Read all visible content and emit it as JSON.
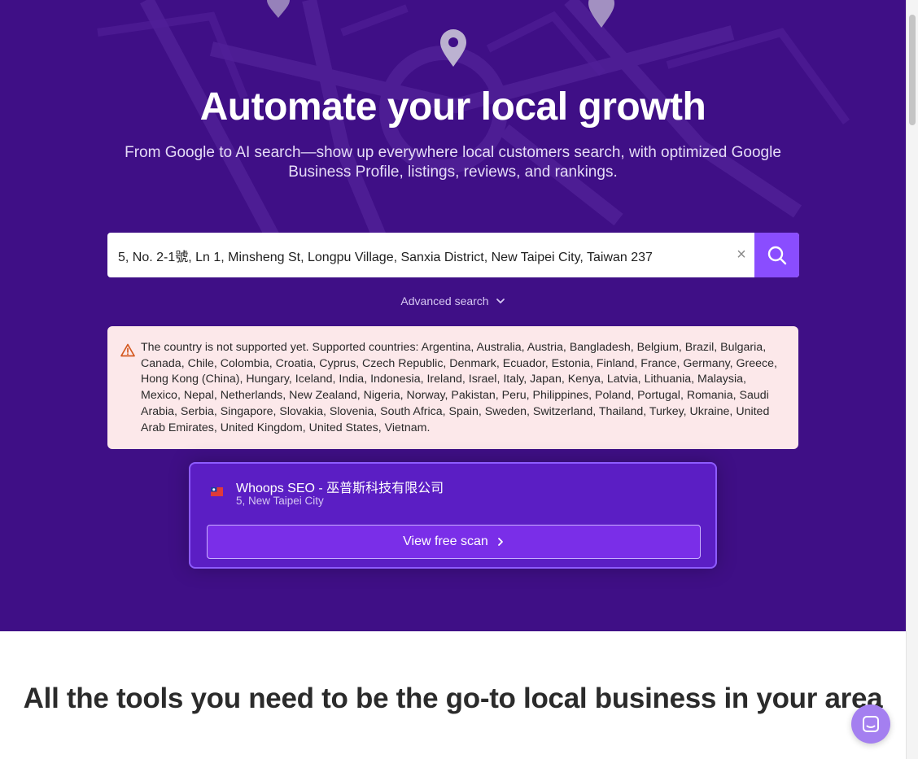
{
  "hero": {
    "title": "Automate your local growth",
    "subtitle": "From Google to AI search—show up everywhere local customers search, with optimized Google Business Profile, listings, reviews, and rankings."
  },
  "search": {
    "value": "5, No. 2-1號, Ln 1, Minsheng St, Longpu Village, Sanxia District, New Taipei City, Taiwan 237",
    "clear_symbol": "×",
    "button_icon": "search-icon"
  },
  "advanced_search": {
    "label": "Advanced search",
    "icon": "chevron-down-icon"
  },
  "alert": {
    "icon": "warning-icon",
    "message": "The country is not supported yet. Supported countries: Argentina, Australia, Austria, Bangladesh, Belgium, Brazil, Bulgaria, Canada, Chile, Colombia, Croatia, Cyprus, Czech Republic, Denmark, Ecuador, Estonia, Finland, France, Germany, Greece, Hong Kong (China), Hungary, Iceland, India, Indonesia, Ireland, Israel, Italy, Japan, Kenya, Latvia, Lithuania, Malaysia, Mexico, Nepal, Netherlands, New Zealand, Nigeria, Norway, Pakistan, Peru, Philippines, Poland, Portugal, Romania, Saudi Arabia, Serbia, Singapore, Slovakia, Slovenia, South Africa, Spain, Sweden, Switzerland, Thailand, Turkey, Ukraine, United Arab Emirates, United Kingdom, United States, Vietnam."
  },
  "result": {
    "flag_icon": "taiwan-flag-icon",
    "name": "Whoops SEO - 巫普斯科技有限公司",
    "address": "5, New Taipei City",
    "button_label": "View free scan",
    "button_icon": "chevron-right-icon"
  },
  "section": {
    "title": "All the tools you need to be the go-to local business in your area"
  },
  "chat": {
    "icon": "chat-icon"
  },
  "colors": {
    "hero_bg": "#3f0f86",
    "accent": "#8a4dff",
    "alert_bg": "#fce8ea",
    "card_bg": "#5b1ec4",
    "chat_bg": "#a47ff0"
  }
}
